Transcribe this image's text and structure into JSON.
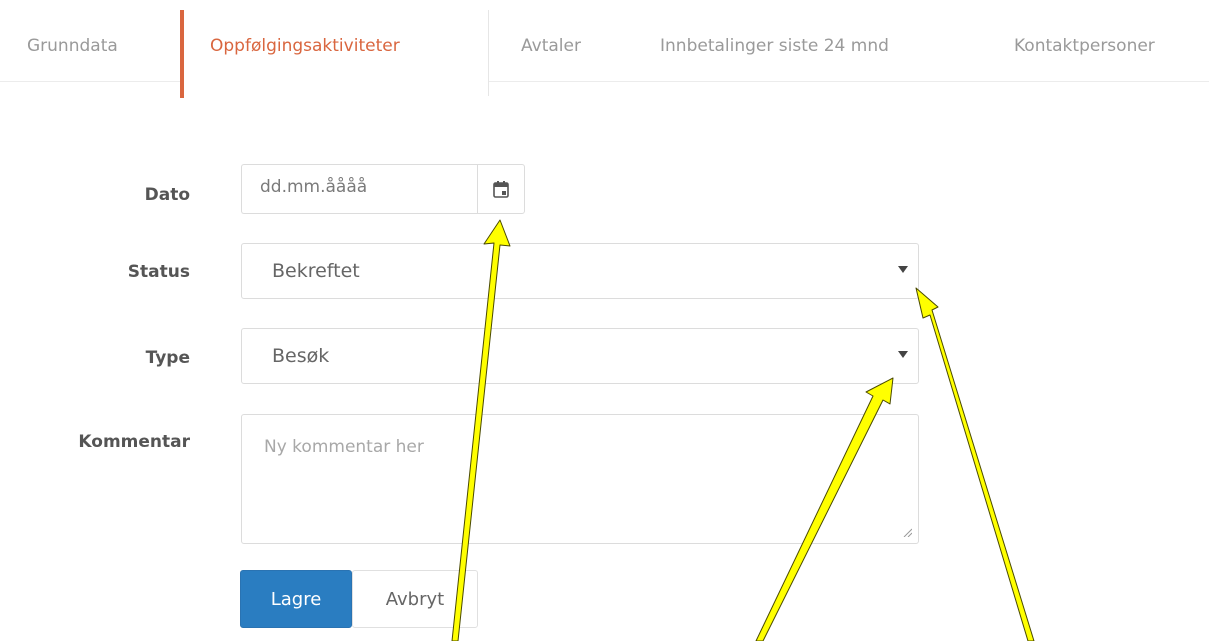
{
  "tabs": [
    {
      "label": "Grunndata",
      "active": false
    },
    {
      "label": "Oppfølgingsaktiviteter",
      "active": true
    },
    {
      "label": "Avtaler",
      "active": false
    },
    {
      "label": "Innbetalinger siste 24 mnd",
      "active": false
    },
    {
      "label": "Kontaktpersoner",
      "active": false
    }
  ],
  "form": {
    "date": {
      "label": "Dato",
      "placeholder": "dd.mm.åååå"
    },
    "status": {
      "label": "Status",
      "value": "Bekreftet"
    },
    "type": {
      "label": "Type",
      "value": "Besøk"
    },
    "comment": {
      "label": "Kommentar",
      "placeholder": "Ny kommentar her"
    },
    "save_label": "Lagre",
    "cancel_label": "Avbryt"
  },
  "colors": {
    "accent": "#d9663f",
    "primary_button": "#2a7dc1",
    "annotation_arrow": "#ffff00"
  },
  "icons": {
    "calendar": "calendar-icon",
    "caret": "caret-down-icon"
  }
}
